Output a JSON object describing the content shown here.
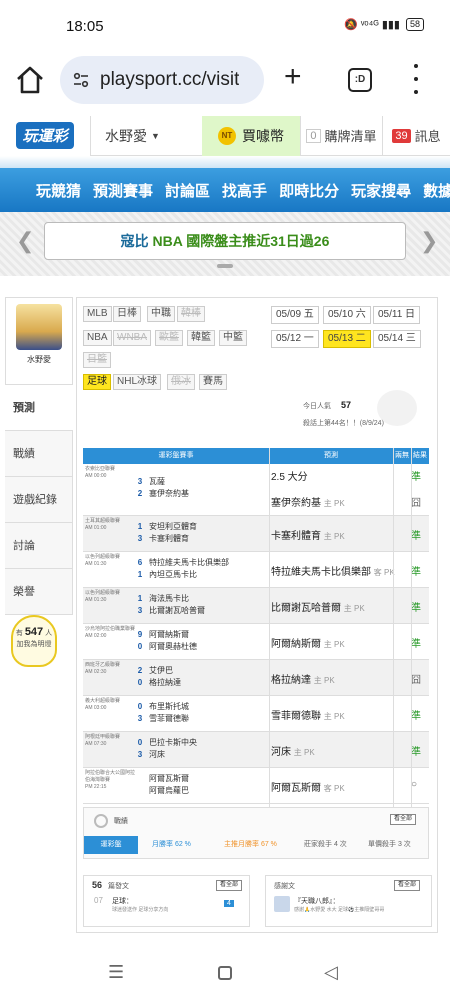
{
  "status": {
    "time": "18:05",
    "icons": "🔕 ᵛᵒ⁴ᴳ ▮▮▮ ",
    "battery": "58"
  },
  "browser": {
    "url": "playsport.cc/visit",
    "tabs_label": ":D"
  },
  "site": {
    "logo": "玩運彩",
    "user": "水野愛",
    "coin_icon": "NT",
    "coin_label": "買噱幣",
    "cart_count": "0",
    "cart_label": "購牌清單",
    "msg_count": "39",
    "msg_label": "訊息"
  },
  "nav": [
    "玩競猜",
    "預測賽事",
    "討論區",
    "找高手",
    "即時比分",
    "玩家搜尋",
    "數據"
  ],
  "banner": {
    "part1": "寇比 ",
    "part2": "NBA 國際盤主推近31日過26"
  },
  "sidebar": {
    "avatar_name": "水野愛",
    "items": [
      "預測",
      "戰績",
      "遊戲紀錄",
      "討論",
      "榮譽"
    ],
    "bulb": {
      "prefix": "有",
      "count": "547",
      "suffix1": "人",
      "suffix2": "加我為明燈"
    }
  },
  "leagues": [
    {
      "label": "MLB",
      "state": "normal"
    },
    {
      "label": "日棒",
      "state": "normal"
    },
    {
      "label": "中職",
      "state": "normal"
    },
    {
      "label": "韓棒",
      "state": "disabled"
    },
    {
      "label": "NBA",
      "state": "normal"
    },
    {
      "label": "WNBA",
      "state": "disabled"
    },
    {
      "label": "歐籃",
      "state": "disabled"
    },
    {
      "label": "韓籃",
      "state": "normal"
    },
    {
      "label": "中籃",
      "state": "normal"
    },
    {
      "label": "日籃",
      "state": "disabled"
    },
    {
      "label": "足球",
      "state": "selected"
    },
    {
      "label": "NHL冰球",
      "state": "normal"
    },
    {
      "label": "俄冰",
      "state": "disabled"
    },
    {
      "label": "賽馬",
      "state": "normal"
    }
  ],
  "dates": [
    {
      "label": "05/09 五",
      "selected": false
    },
    {
      "label": "05/10 六",
      "selected": false
    },
    {
      "label": "05/11 日",
      "selected": false
    },
    {
      "label": "05/12 一",
      "selected": false
    },
    {
      "label": "05/13 二",
      "selected": true
    },
    {
      "label": "05/14 三",
      "selected": false
    }
  ],
  "stats": {
    "today_label": "今日人氣",
    "today_value": "57",
    "rank": "殺話上第44名！！(8/9/24)"
  },
  "table": {
    "headers": [
      "運彩盤賽事",
      "預測",
      "兩無",
      "結果"
    ],
    "rows": [
      {
        "league": "衣索比亞聯賽",
        "time": "AM 00:00",
        "s1": "3",
        "s2": "2",
        "t1": "瓦薩",
        "t2": "塞伊奈約基",
        "pick": "2.5 大分",
        "pick2": "塞伊奈約基",
        "sub": "主 PK",
        "res": "準",
        "res2": "囧",
        "alt": false,
        "tall": true
      },
      {
        "league": "土耳其超級聯賽",
        "time": "AM 01:00",
        "s1": "1",
        "s2": "3",
        "t1": "安坦利亞體育",
        "t2": "卡塞利體育",
        "pick": "卡塞利體育",
        "sub": "主 PK",
        "res": "準",
        "alt": true
      },
      {
        "league": "以色列超級聯賽",
        "time": "AM 01:30",
        "s1": "6",
        "s2": "1",
        "t1": "特拉維夫馬卡比俱樂部",
        "t2": "內坦亞馬卡比",
        "pick": "特拉維夫馬卡比俱樂部",
        "sub": "客 PK",
        "res": "準",
        "alt": false
      },
      {
        "league": "以色列超級聯賽",
        "time": "AM 01:30",
        "s1": "1",
        "s2": "3",
        "t1": "海法馬卡比",
        "t2": "比爾謝瓦哈普爾",
        "pick": "比爾謝瓦哈普爾",
        "sub": "主 PK",
        "res": "準",
        "alt": true
      },
      {
        "league": "沙烏地阿拉伯職業聯賽",
        "time": "AM 02:00",
        "s1": "9",
        "s2": "0",
        "t1": "阿爾納斯爾",
        "t2": "阿爾奧赫杜德",
        "pick": "阿爾納斯爾",
        "sub": "主 PK",
        "res": "準",
        "alt": false
      },
      {
        "league": "西班牙乙級聯賽",
        "time": "AM 02:30",
        "s1": "2",
        "s2": "0",
        "t1": "艾伊巴",
        "t2": "格拉納達",
        "pick": "格拉納達",
        "sub": "主 PK",
        "res": "囧",
        "alt": true
      },
      {
        "league": "義大利超級聯賽",
        "time": "AM 03:00",
        "s1": "0",
        "s2": "3",
        "t1": "布里斯托城",
        "t2": "雪菲爾德聯",
        "pick": "雪菲爾德聯",
        "sub": "主 PK",
        "res": "準",
        "alt": false
      },
      {
        "league": "阿根廷甲級聯賽",
        "time": "AM 07:30",
        "s1": "0",
        "s2": "3",
        "t1": "巴拉卡斯中央",
        "t2": "河床",
        "pick": "河床",
        "sub": "主 PK",
        "res": "準",
        "alt": true
      },
      {
        "league": "阿拉伯聯合大公國阿拉伯海灣聯賽",
        "time": "PM 22:15",
        "s1": "",
        "s2": "",
        "t1": "阿爾瓦斯爾",
        "t2": "阿爾烏蘿巴",
        "pick": "阿爾瓦斯爾",
        "sub": "客 PK",
        "res": "○",
        "alt": false
      }
    ]
  },
  "record": {
    "title": "戰績",
    "view_all": "看全部",
    "tag": "運彩盤",
    "a": "月勝率 62 %",
    "b": "主推月勝率 67 %",
    "c": "莊家殺手 4 次",
    "d": "單價殺手 3 次"
  },
  "box_left": {
    "count": "56",
    "title": "篇發文",
    "view_all": "看全部",
    "date": "07",
    "subject": "足球：",
    "desc": "球迷發送作 足球分享方向",
    "badge": "4"
  },
  "box_right": {
    "title": "感謝文",
    "view_all": "看全部",
    "subject": "『天職八郎』：",
    "desc": "感謝🙏水野愛 水大 足球⚽主推隔壁哥哥"
  }
}
